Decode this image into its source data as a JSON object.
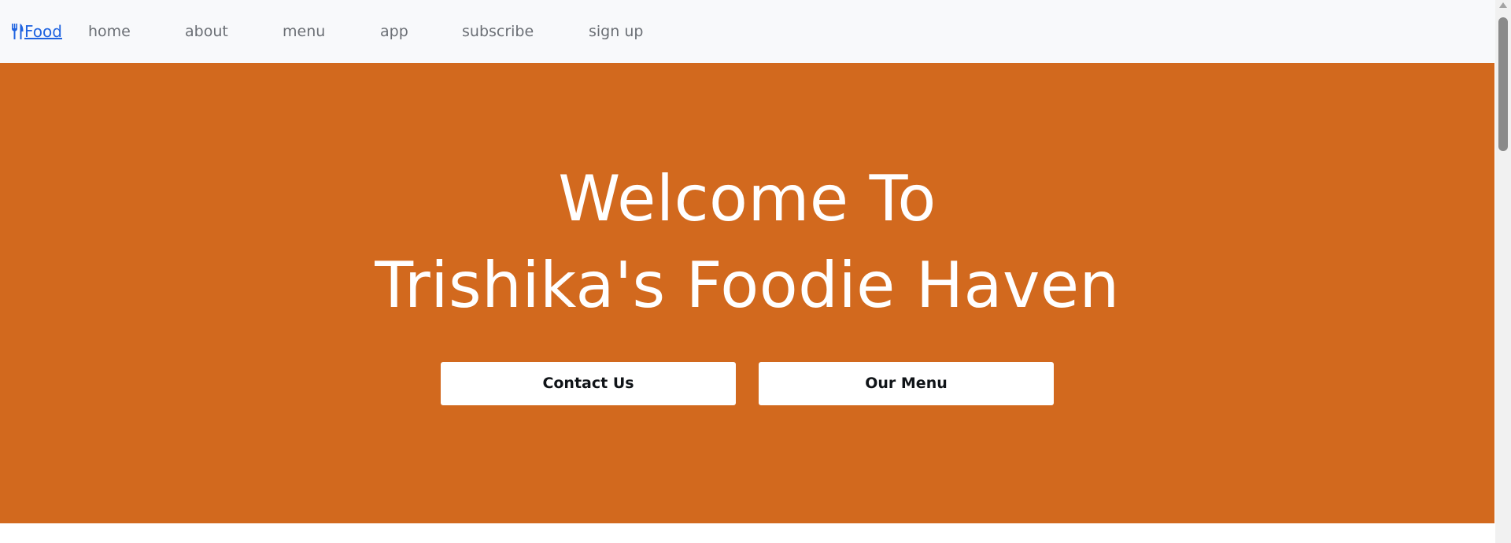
{
  "navbar": {
    "brand_label": "Food",
    "brand_icon": "utensils-icon",
    "links": [
      {
        "label": "home"
      },
      {
        "label": "about"
      },
      {
        "label": "menu"
      },
      {
        "label": "app"
      },
      {
        "label": "subscribe"
      },
      {
        "label": "sign up"
      }
    ]
  },
  "hero": {
    "title_line1": "Welcome To",
    "title_line2": "Trishika's Foodie Haven",
    "contact_label": "Contact Us",
    "menu_label": "Our Menu",
    "background_color": "#d2691e"
  },
  "colors": {
    "navbar_bg": "#f8f9fb",
    "brand_link": "#1f63e0",
    "nav_text": "#6b6f75",
    "button_bg": "#ffffff",
    "button_text": "#101418"
  }
}
